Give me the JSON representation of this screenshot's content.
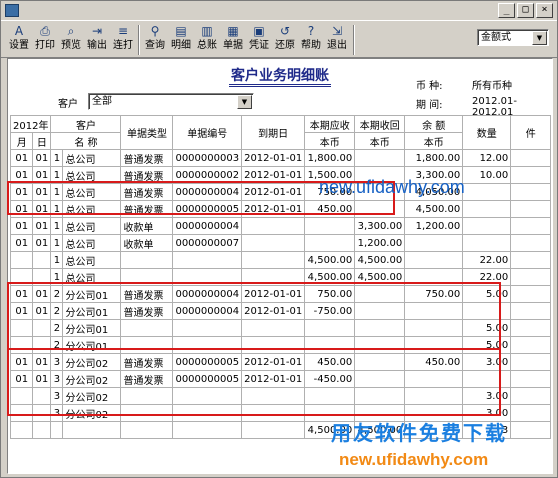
{
  "window": {
    "min": "_",
    "max": "□",
    "close": "×"
  },
  "toolbar": {
    "buttons": [
      {
        "label": "设置",
        "icon": "settings-icon",
        "glyph": "A"
      },
      {
        "label": "打印",
        "icon": "printer-icon",
        "glyph": "⎙"
      },
      {
        "label": "预览",
        "icon": "preview-icon",
        "glyph": "⌕"
      },
      {
        "label": "输出",
        "icon": "export-icon",
        "glyph": "⇥"
      },
      {
        "label": "连打",
        "icon": "batch-print-icon",
        "glyph": "≡"
      },
      {
        "label": "查询",
        "icon": "binoculars-icon",
        "glyph": "⚲"
      },
      {
        "label": "明细",
        "icon": "detail-icon",
        "glyph": "▤"
      },
      {
        "label": "总账",
        "icon": "ledger-icon",
        "glyph": "▥"
      },
      {
        "label": "单据",
        "icon": "document-icon",
        "glyph": "▦"
      },
      {
        "label": "凭证",
        "icon": "voucher-icon",
        "glyph": "▣"
      },
      {
        "label": "还原",
        "icon": "restore-icon",
        "glyph": "↺"
      },
      {
        "label": "帮助",
        "icon": "help-icon",
        "glyph": "?"
      },
      {
        "label": "退出",
        "icon": "exit-icon",
        "glyph": "⇲"
      }
    ],
    "format_select": "金额式"
  },
  "report": {
    "title": "客户业务明细账",
    "currency_label": "币    种:",
    "currency_value": "所有币种",
    "period_label": "期    间:",
    "period_value": "2012.01-2012.01",
    "customer_label": "客户",
    "customer_value": "全部"
  },
  "table": {
    "year": "2012年",
    "h_customer": "客户",
    "h_month": "月",
    "h_day": "日",
    "h_name": "名  称",
    "h_doctype": "单据类型",
    "h_docno": "单据编号",
    "h_due": "到期日",
    "h_debit": "本期应收",
    "h_credit": "本期收回",
    "h_balance": "余  额",
    "h_sub": "本币",
    "h_qty": "数量",
    "h_more": "件",
    "rows": [
      [
        "01",
        "01",
        "1",
        "总公司",
        "普通发票",
        "0000000003",
        "2012-01-01",
        "1,800.00",
        "",
        "1,800.00",
        "12.00"
      ],
      [
        "01",
        "01",
        "1",
        "总公司",
        "普通发票",
        "0000000002",
        "2012-01-01",
        "1,500.00",
        "",
        "3,300.00",
        "10.00"
      ],
      [
        "01",
        "01",
        "1",
        "总公司",
        "普通发票",
        "0000000004",
        "2012-01-01",
        "750.00",
        "",
        "4,050.00",
        ""
      ],
      [
        "01",
        "01",
        "1",
        "总公司",
        "普通发票",
        "0000000005",
        "2012-01-01",
        "450.00",
        "",
        "4,500.00",
        ""
      ],
      [
        "01",
        "01",
        "1",
        "总公司",
        "收款单",
        "0000000004",
        "",
        "",
        "3,300.00",
        "1,200.00",
        ""
      ],
      [
        "01",
        "01",
        "1",
        "总公司",
        "收款单",
        "0000000007",
        "",
        "",
        "1,200.00",
        "",
        ""
      ],
      [
        "",
        "",
        "1",
        "总公司",
        "",
        "",
        "",
        "4,500.00",
        "4,500.00",
        "",
        "22.00"
      ],
      [
        "",
        "",
        "1",
        "总公司",
        "",
        "",
        "",
        "4,500.00",
        "4,500.00",
        "",
        "22.00"
      ],
      [
        "01",
        "01",
        "2",
        "分公司01",
        "普通发票",
        "0000000004",
        "2012-01-01",
        "750.00",
        "",
        "750.00",
        "5.00"
      ],
      [
        "01",
        "01",
        "2",
        "分公司01",
        "普通发票",
        "0000000004",
        "2012-01-01",
        "-750.00",
        "",
        "",
        ""
      ],
      [
        "",
        "",
        "2",
        "分公司01",
        "",
        "",
        "",
        "",
        "",
        "",
        "5.00"
      ],
      [
        "",
        "",
        "2",
        "分公司01",
        "",
        "",
        "",
        "",
        "",
        "",
        "5.00"
      ],
      [
        "01",
        "01",
        "3",
        "分公司02",
        "普通发票",
        "0000000005",
        "2012-01-01",
        "450.00",
        "",
        "450.00",
        "3.00"
      ],
      [
        "01",
        "01",
        "3",
        "分公司02",
        "普通发票",
        "0000000005",
        "2012-01-01",
        "-450.00",
        "",
        "",
        ""
      ],
      [
        "",
        "",
        "3",
        "分公司02",
        "",
        "",
        "",
        "",
        "",
        "",
        "3.00"
      ],
      [
        "",
        "",
        "3",
        "分公司02",
        "",
        "",
        "",
        "",
        "",
        "",
        "3.00"
      ],
      [
        "",
        "",
        "",
        "",
        "",
        "",
        "",
        "4,500.00",
        "4,500.00",
        "",
        "3"
      ]
    ]
  },
  "watermark": {
    "site": "new.ufidawhy.com",
    "slogan": "用友软件免费下载",
    "site2": "new.ufidawhy.com"
  }
}
